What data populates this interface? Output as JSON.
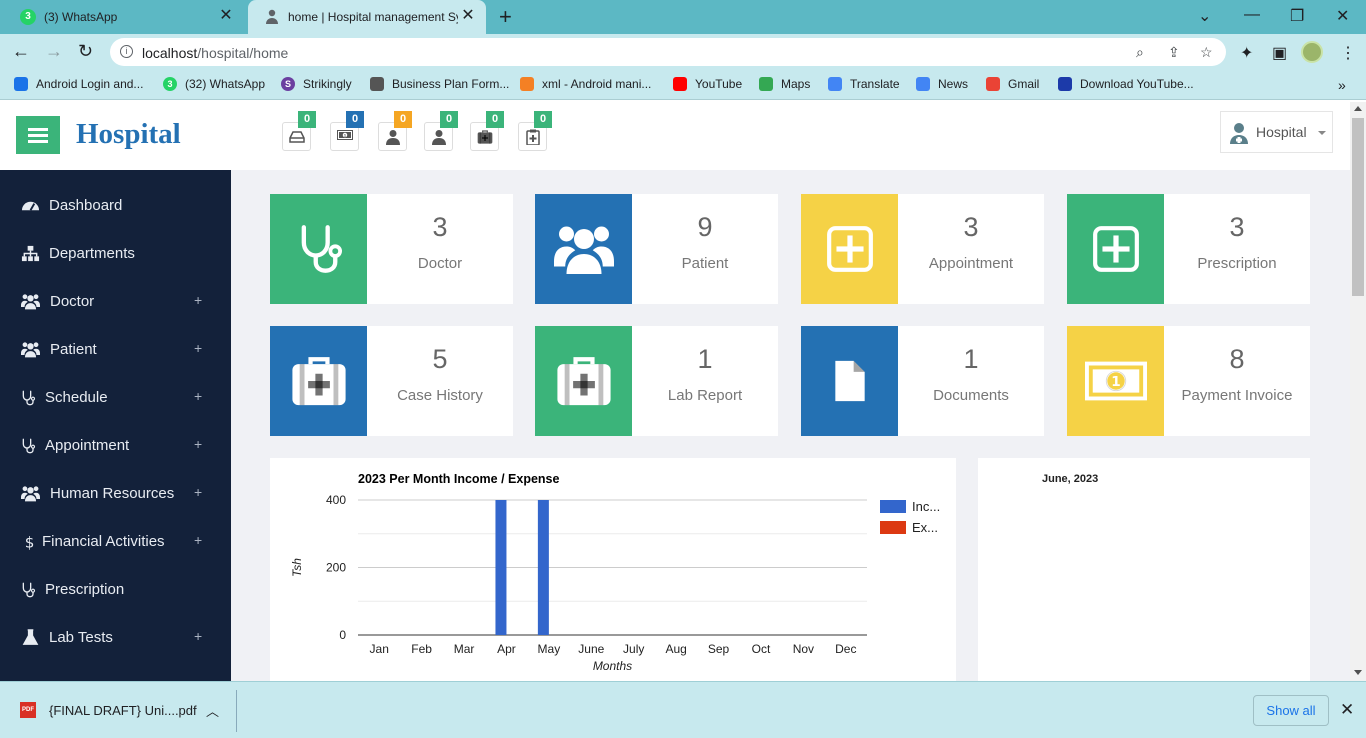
{
  "browser": {
    "tabs": [
      {
        "title": "(3) WhatsApp",
        "favicon_badge": "3",
        "active": false
      },
      {
        "title": "home | Hospital management Sys",
        "active": true
      }
    ],
    "new_tab_symbol": "+",
    "url_host": "localhost",
    "url_path": "/hospital/home",
    "bookmarks": [
      {
        "label": "Android Login and...",
        "icon": "android-studio-icon",
        "color": "#1a73e8"
      },
      {
        "label": "(32) WhatsApp",
        "icon": "whatsapp-icon",
        "color": "#25d366",
        "badge": "3"
      },
      {
        "label": "Strikingly",
        "icon": "strikingly-icon",
        "color": "#6b3fa0",
        "badge": "S"
      },
      {
        "label": "Business Plan Form...",
        "icon": "openai-icon",
        "color": "#555555"
      },
      {
        "label": "xml - Android mani...",
        "icon": "stackoverflow-icon",
        "color": "#f48024"
      },
      {
        "label": "YouTube",
        "icon": "youtube-icon",
        "color": "#ff0000"
      },
      {
        "label": "Maps",
        "icon": "maps-icon",
        "color": "#34a853"
      },
      {
        "label": "Translate",
        "icon": "translate-icon",
        "color": "#4285f4"
      },
      {
        "label": "News",
        "icon": "news-icon",
        "color": "#4285f4"
      },
      {
        "label": "Gmail",
        "icon": "gmail-icon",
        "color": "#ea4335"
      },
      {
        "label": "Download YouTube...",
        "icon": "download-icon",
        "color": "#1c3aa9"
      }
    ]
  },
  "header": {
    "brand": "Hospital",
    "user_name": "Hospital",
    "notifications": [
      {
        "icon": "hdd-icon",
        "count": "0",
        "color": "#3bb47a"
      },
      {
        "icon": "money-icon",
        "count": "0",
        "color": "#2471b3"
      },
      {
        "icon": "user-icon",
        "count": "0",
        "color": "#f5a623"
      },
      {
        "icon": "user-icon",
        "count": "0",
        "color": "#3bb47a"
      },
      {
        "icon": "medkit-icon",
        "count": "0",
        "color": "#3bb47a"
      },
      {
        "icon": "clipboard-icon",
        "count": "0",
        "color": "#3bb47a"
      }
    ]
  },
  "sidebar": {
    "items": [
      {
        "label": "Dashboard",
        "icon": "dashboard-icon",
        "expandable": false
      },
      {
        "label": "Departments",
        "icon": "sitemap-icon",
        "expandable": false
      },
      {
        "label": "Doctor",
        "icon": "users-icon",
        "expandable": true
      },
      {
        "label": "Patient",
        "icon": "users-icon",
        "expandable": true
      },
      {
        "label": "Schedule",
        "icon": "stethoscope-icon",
        "expandable": true
      },
      {
        "label": "Appointment",
        "icon": "stethoscope-icon",
        "expandable": true
      },
      {
        "label": "Human Resources",
        "icon": "users-icon",
        "expandable": true
      },
      {
        "label": "Financial Activities",
        "icon": "dollar-icon",
        "expandable": true
      },
      {
        "label": "Prescription",
        "icon": "stethoscope-icon",
        "expandable": false
      },
      {
        "label": "Lab Tests",
        "icon": "flask-icon",
        "expandable": true
      }
    ],
    "expand_symbol": "+"
  },
  "stats": [
    {
      "value": "3",
      "label": "Doctor",
      "icon": "stethoscope-icon",
      "color": "#3bb47a"
    },
    {
      "value": "9",
      "label": "Patient",
      "icon": "users-icon",
      "color": "#2471b3"
    },
    {
      "value": "3",
      "label": "Appointment",
      "icon": "plus-square-icon",
      "color": "#f5d246"
    },
    {
      "value": "3",
      "label": "Prescription",
      "icon": "plus-square-icon",
      "color": "#3bb47a"
    },
    {
      "value": "5",
      "label": "Case History",
      "icon": "medkit-icon",
      "color": "#2471b3"
    },
    {
      "value": "1",
      "label": "Lab Report",
      "icon": "medkit-icon",
      "color": "#3bb47a"
    },
    {
      "value": "1",
      "label": "Documents",
      "icon": "file-icon",
      "color": "#2471b3"
    },
    {
      "value": "8",
      "label": "Payment Invoice",
      "icon": "money-icon",
      "color": "#f5d246"
    }
  ],
  "chart_data": {
    "type": "bar",
    "title": "2023 Per Month Income / Expense",
    "xlabel": "Months",
    "ylabel": "Tsh",
    "categories": [
      "Jan",
      "Feb",
      "Mar",
      "Apr",
      "May",
      "June",
      "July",
      "Aug",
      "Sep",
      "Oct",
      "Nov",
      "Dec"
    ],
    "series": [
      {
        "name": "Inc...",
        "color": "#3366cc",
        "values": [
          0,
          0,
          0,
          400,
          400,
          0,
          0,
          0,
          0,
          0,
          0,
          0
        ]
      },
      {
        "name": "Ex...",
        "color": "#dc3912",
        "values": [
          0,
          0,
          0,
          0,
          0,
          0,
          0,
          0,
          0,
          0,
          0,
          0
        ]
      }
    ],
    "yticks": [
      0,
      200,
      400
    ],
    "ylim": [
      0,
      400
    ],
    "legend": "right",
    "grid": true
  },
  "calendar": {
    "title": "June, 2023"
  },
  "downloads": {
    "file_name": "{FINAL DRAFT} Uni....pdf",
    "file_badge": "PDF",
    "show_all": "Show all"
  }
}
